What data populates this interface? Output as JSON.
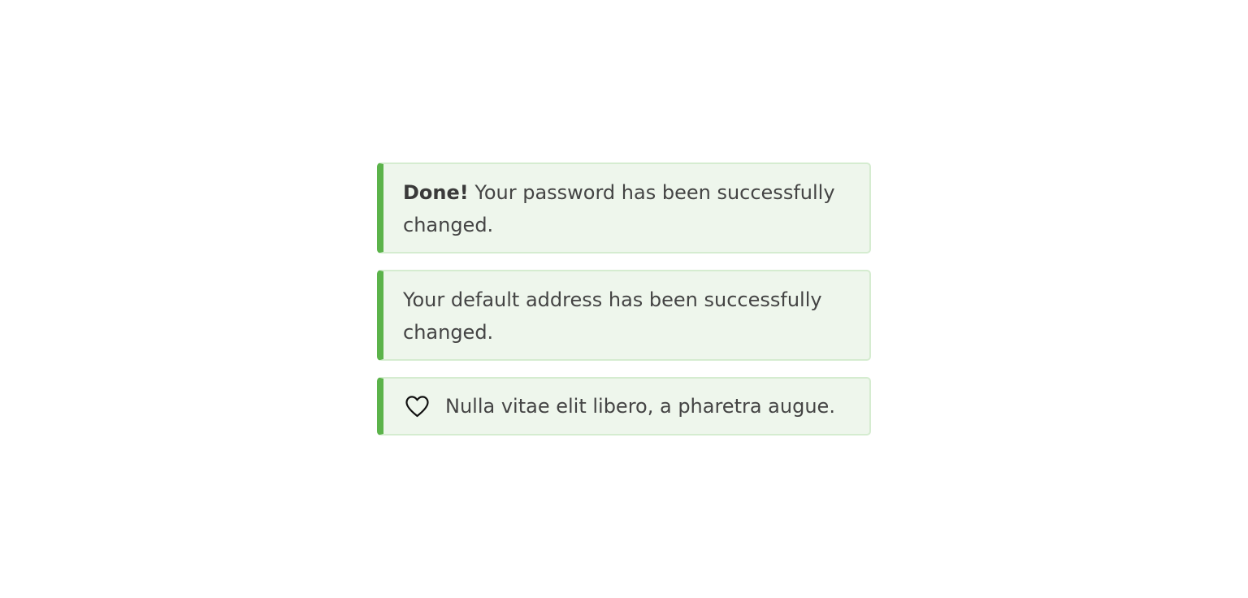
{
  "alerts": [
    {
      "strong": "Done!",
      "text": " Your password has been successfully changed."
    },
    {
      "text": "Your default address has been successfully changed."
    },
    {
      "icon": "heart-icon",
      "text": "Nulla vitae elit libero, a pharetra augue."
    }
  ],
  "colors": {
    "accent": "#5bb34a",
    "background": "#eef6ec",
    "border": "#d5ecd0",
    "text": "#444444"
  }
}
